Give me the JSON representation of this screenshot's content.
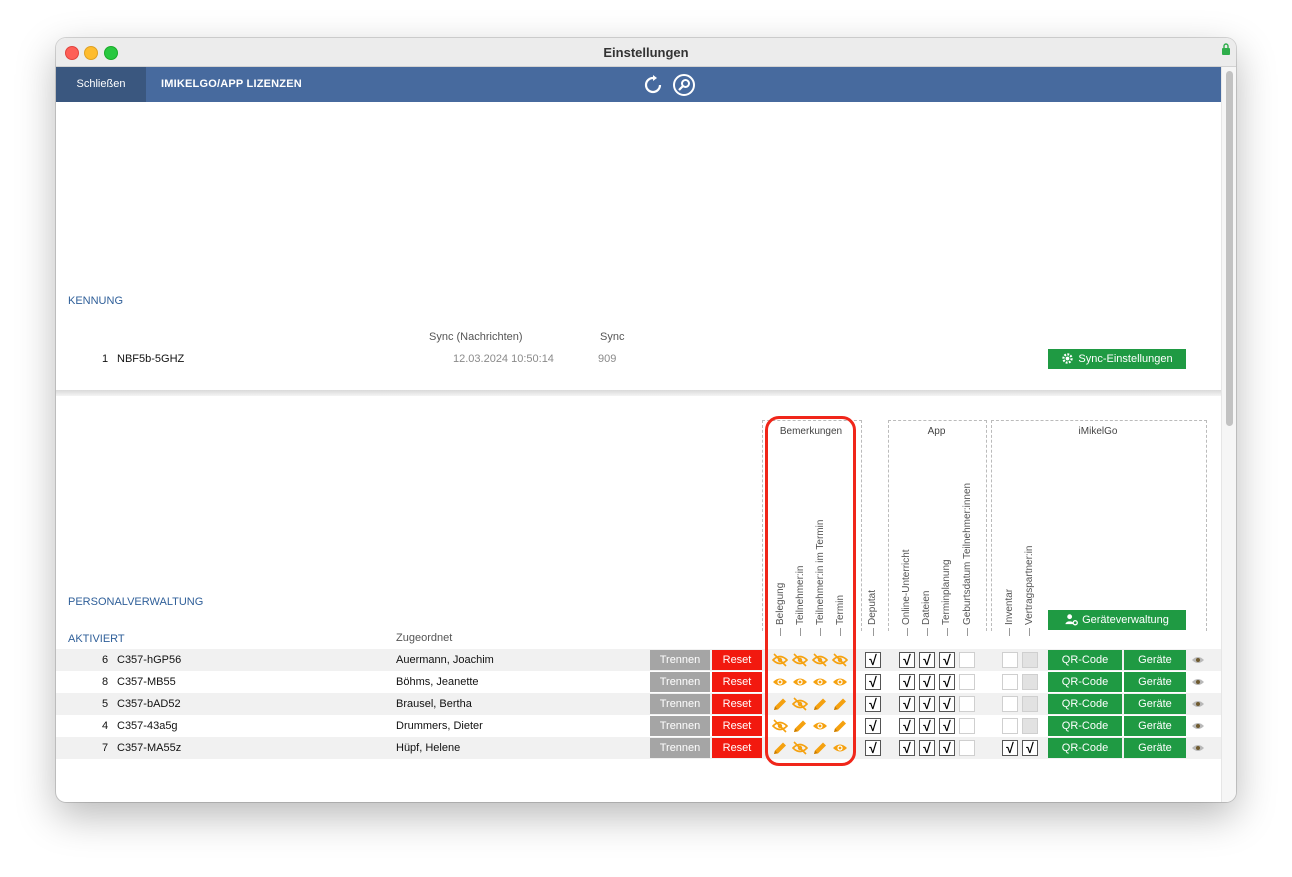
{
  "window": {
    "title": "Einstellungen"
  },
  "toolbar": {
    "close_label": "Schließen",
    "licenses_label": "IMIKELGO/APP LIZENZEN"
  },
  "kennung": {
    "section_label": "KENNUNG",
    "col_sync_msg": "Sync (Nachrichten)",
    "col_sync": "Sync",
    "row": {
      "index": "1",
      "id": "NBF5b-5GHZ",
      "sync_msg": "12.03.2024 10:50:14",
      "sync": "909"
    },
    "sync_settings_label": "Sync-Einstellungen"
  },
  "personal": {
    "section_label": "PERSONALVERWALTUNG",
    "activated_label": "AKTIVIERT",
    "assigned_label": "Zugeordnet",
    "group_bemerkungen": "Bemerkungen",
    "group_app": "App",
    "group_imikelgo": "iMikelGo",
    "col_belegung": "Belegung",
    "col_teilnehmer": "Teilnehmer:in",
    "col_teilnehmer_termin": "Teilnehmer:in im Termin",
    "col_termin": "Termin",
    "col_deputat": "Deputat",
    "col_online": "Online-Unterricht",
    "col_dateien": "Dateien",
    "col_terminplanung": "Terminplanung",
    "col_geburtsdatum": "Geburtsdatum Teilnehmer:innen",
    "col_inventar": "Inventar",
    "col_vertragspartner": "Vertragspartner:in",
    "device_mgmt_label": "Geräteverwaltung",
    "btn_trennen": "Trennen",
    "btn_reset": "Reset",
    "btn_qr": "QR-Code",
    "btn_geraete": "Geräte",
    "check_mark": "√",
    "rows": [
      {
        "index": "6",
        "id": "C357-hGP56",
        "name": "Auermann, Joachim",
        "remarks": [
          "eye-off",
          "eye-off",
          "eye-off",
          "eye-off"
        ],
        "deputat": true,
        "app": [
          true,
          true,
          true,
          false
        ],
        "imikelgo": [
          false,
          false
        ]
      },
      {
        "index": "8",
        "id": "C357-MB55",
        "name": "Böhms, Jeanette",
        "remarks": [
          "eye",
          "eye",
          "eye",
          "eye"
        ],
        "deputat": true,
        "app": [
          true,
          true,
          true,
          false
        ],
        "imikelgo": [
          false,
          false
        ]
      },
      {
        "index": "5",
        "id": "C357-bAD52",
        "name": "Brausel, Bertha",
        "remarks": [
          "pencil",
          "eye-off",
          "pencil",
          "pencil"
        ],
        "deputat": true,
        "app": [
          true,
          true,
          true,
          false
        ],
        "imikelgo": [
          false,
          false
        ]
      },
      {
        "index": "4",
        "id": "C357-43a5g",
        "name": "Drummers, Dieter",
        "remarks": [
          "eye-off",
          "pencil",
          "eye",
          "pencil"
        ],
        "deputat": true,
        "app": [
          true,
          true,
          true,
          false
        ],
        "imikelgo": [
          false,
          false
        ]
      },
      {
        "index": "7",
        "id": "C357-MA55z",
        "name": "Hüpf, Helene",
        "remarks": [
          "pencil",
          "eye-off",
          "pencil",
          "eye"
        ],
        "deputat": true,
        "app": [
          true,
          true,
          true,
          false
        ],
        "imikelgo": [
          true,
          true
        ]
      }
    ]
  },
  "colors": {
    "toolbar": "#476a9e",
    "section_link": "#2f5f99",
    "green_button": "#1f9a43",
    "red_button": "#f2190f",
    "gray_button": "#a5a5a5",
    "remark_icon": "#f5a10f",
    "highlight": "#f0261a"
  }
}
